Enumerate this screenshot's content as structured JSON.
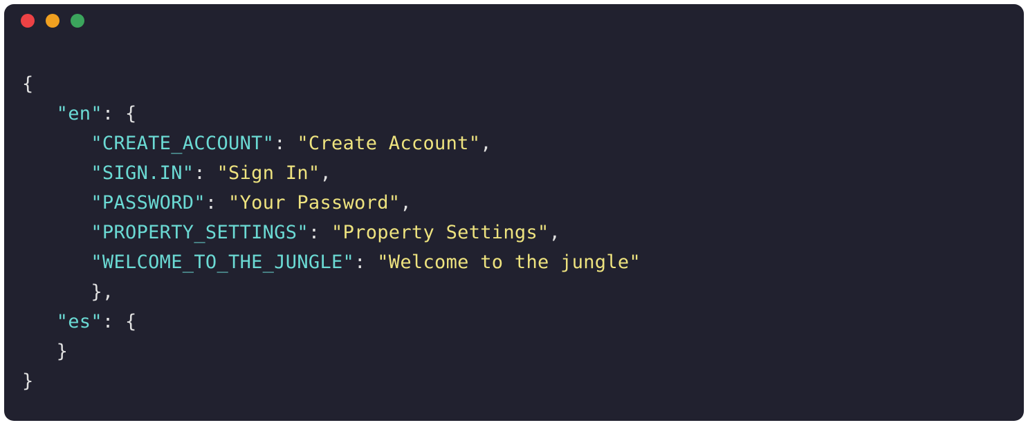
{
  "code": {
    "l1": {
      "p1": "{"
    },
    "l2": {
      "pad": "   ",
      "k": "\"en\"",
      "p1": ": {"
    },
    "l3": {
      "pad": "      ",
      "k": "\"CREATE_ACCOUNT\"",
      "p1": ": ",
      "v": "\"Create Account\"",
      "p2": ","
    },
    "l4": {
      "pad": "      ",
      "k": "\"SIGN.IN\"",
      "p1": ": ",
      "v": "\"Sign In\"",
      "p2": ","
    },
    "l5": {
      "pad": "      ",
      "k": "\"PASSWORD\"",
      "p1": ": ",
      "v": "\"Your Password\"",
      "p2": ","
    },
    "l6": {
      "pad": "      ",
      "k": "\"PROPERTY_SETTINGS\"",
      "p1": ": ",
      "v": "\"Property Settings\"",
      "p2": ","
    },
    "l7": {
      "pad": "      ",
      "k": "\"WELCOME_TO_THE_JUNGLE\"",
      "p1": ": ",
      "v": "\"Welcome to the jungle\""
    },
    "l8": {
      "pad": "      ",
      "p1": "},"
    },
    "l9": {
      "pad": "   ",
      "k": "\"es\"",
      "p1": ": {"
    },
    "l10": {
      "pad": "   ",
      "p1": "}"
    },
    "l11": {
      "p1": "}"
    }
  }
}
